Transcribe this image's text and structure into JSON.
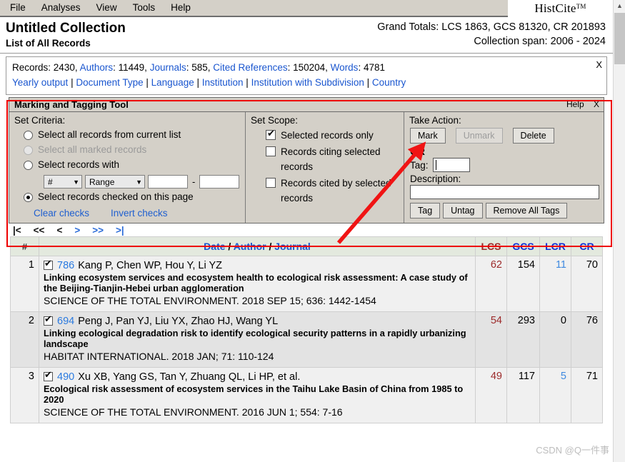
{
  "menu": {
    "items": [
      "File",
      "Analyses",
      "View",
      "Tools",
      "Help"
    ],
    "logo": "HistCite",
    "logo_tm": "TM"
  },
  "header": {
    "collection_title": "Untitled Collection",
    "collection_subtitle": "List of All Records",
    "grand_totals": "Grand Totals: LCS 1863, GCS 81320, CR 201893",
    "collection_span": "Collection span: 2006 - 2024"
  },
  "stats": {
    "records_label": "Records:",
    "records_value": "2430,",
    "authors_label": "Authors",
    "authors_value": ": 11449,",
    "journals_label": "Journals",
    "journals_value": ": 585,",
    "cited_refs_label": "Cited References",
    "cited_refs_value": ": 150204,",
    "words_label": "Words",
    "words_value": ": 4781",
    "links": [
      "Yearly output",
      "Document Type",
      "Language",
      "Institution",
      "Institution with Subdivision",
      "Country"
    ],
    "close": "X"
  },
  "marking_tool": {
    "title": "Marking and Tagging Tool",
    "help": "Help",
    "close": "X",
    "set_criteria": {
      "heading": "Set Criteria:",
      "options": [
        {
          "label": "Select all records from current list",
          "selected": false,
          "disabled": false
        },
        {
          "label": "Select all marked records",
          "selected": false,
          "disabled": true
        },
        {
          "label": "Select records with",
          "selected": false,
          "disabled": false
        },
        {
          "label": "Select records checked on this page",
          "selected": true,
          "disabled": false
        }
      ],
      "field_select": "#",
      "mode_select": "Range",
      "range_from": "",
      "range_to": "",
      "clear_checks": "Clear checks",
      "invert_checks": "Invert checks"
    },
    "set_scope": {
      "heading": "Set Scope:",
      "options": [
        {
          "label": "Selected records only",
          "checked": true
        },
        {
          "label": "Records citing selected records",
          "checked": false
        },
        {
          "label": "Records cited by selected records",
          "checked": false
        }
      ]
    },
    "take_action": {
      "heading": "Take Action:",
      "mark": "Mark",
      "unmark": "Unmark",
      "delete": "Delete",
      "or": "OR",
      "tag_label": "Tag:",
      "tag_value": "",
      "description_label": "Description:",
      "description_value": "",
      "tag_button": "Tag",
      "untag_button": "Untag",
      "remove_all_tags": "Remove All Tags"
    }
  },
  "pager": {
    "first": "|<",
    "prev_block": "<<",
    "prev": "<",
    "next": ">",
    "next_block": ">>",
    "last": ">|"
  },
  "table": {
    "headers": {
      "num": "#",
      "date": "Date",
      "slash1": "/",
      "author": "Author",
      "slash2": "/",
      "journal": "Journal",
      "lcs": "LCS",
      "gcs": "GCS",
      "lcr": "LCR",
      "cr": "CR"
    },
    "rows": [
      {
        "num": "1",
        "checked": true,
        "id": "786",
        "authors": "Kang P, Chen WP, Hou Y, Li YZ",
        "title": "Linking ecosystem services and ecosystem health to ecological risk assessment: A case study of the Beijing-Tianjin-Hebei urban agglomeration",
        "source": "SCIENCE OF THE TOTAL ENVIRONMENT. 2018 SEP 15; 636: 1442-1454",
        "lcs": "62",
        "gcs": "154",
        "lcr": "11",
        "cr": "70"
      },
      {
        "num": "2",
        "checked": true,
        "id": "694",
        "authors": "Peng J, Pan YJ, Liu YX, Zhao HJ, Wang YL",
        "title": "Linking ecological degradation risk to identify ecological security patterns in a rapidly urbanizing landscape",
        "source": "HABITAT INTERNATIONAL. 2018 JAN; 71: 110-124",
        "lcs": "54",
        "gcs": "293",
        "lcr": "0",
        "cr": "76"
      },
      {
        "num": "3",
        "checked": true,
        "id": "490",
        "authors": "Xu XB, Yang GS, Tan Y, Zhuang QL, Li HP, et al.",
        "title": "Ecological risk assessment of ecosystem services in the Taihu Lake Basin of China from 1985 to 2020",
        "source": "SCIENCE OF THE TOTAL ENVIRONMENT. 2016 JUN 1; 554: 7-16",
        "lcs": "49",
        "gcs": "117",
        "lcr": "5",
        "cr": "71"
      }
    ]
  },
  "watermark": "CSDN @Q一件事",
  "colors": {
    "link": "#1a56cf",
    "lcs": "#9c2a2a",
    "annotation": "#ee0000",
    "panel": "#d4d0c8"
  }
}
